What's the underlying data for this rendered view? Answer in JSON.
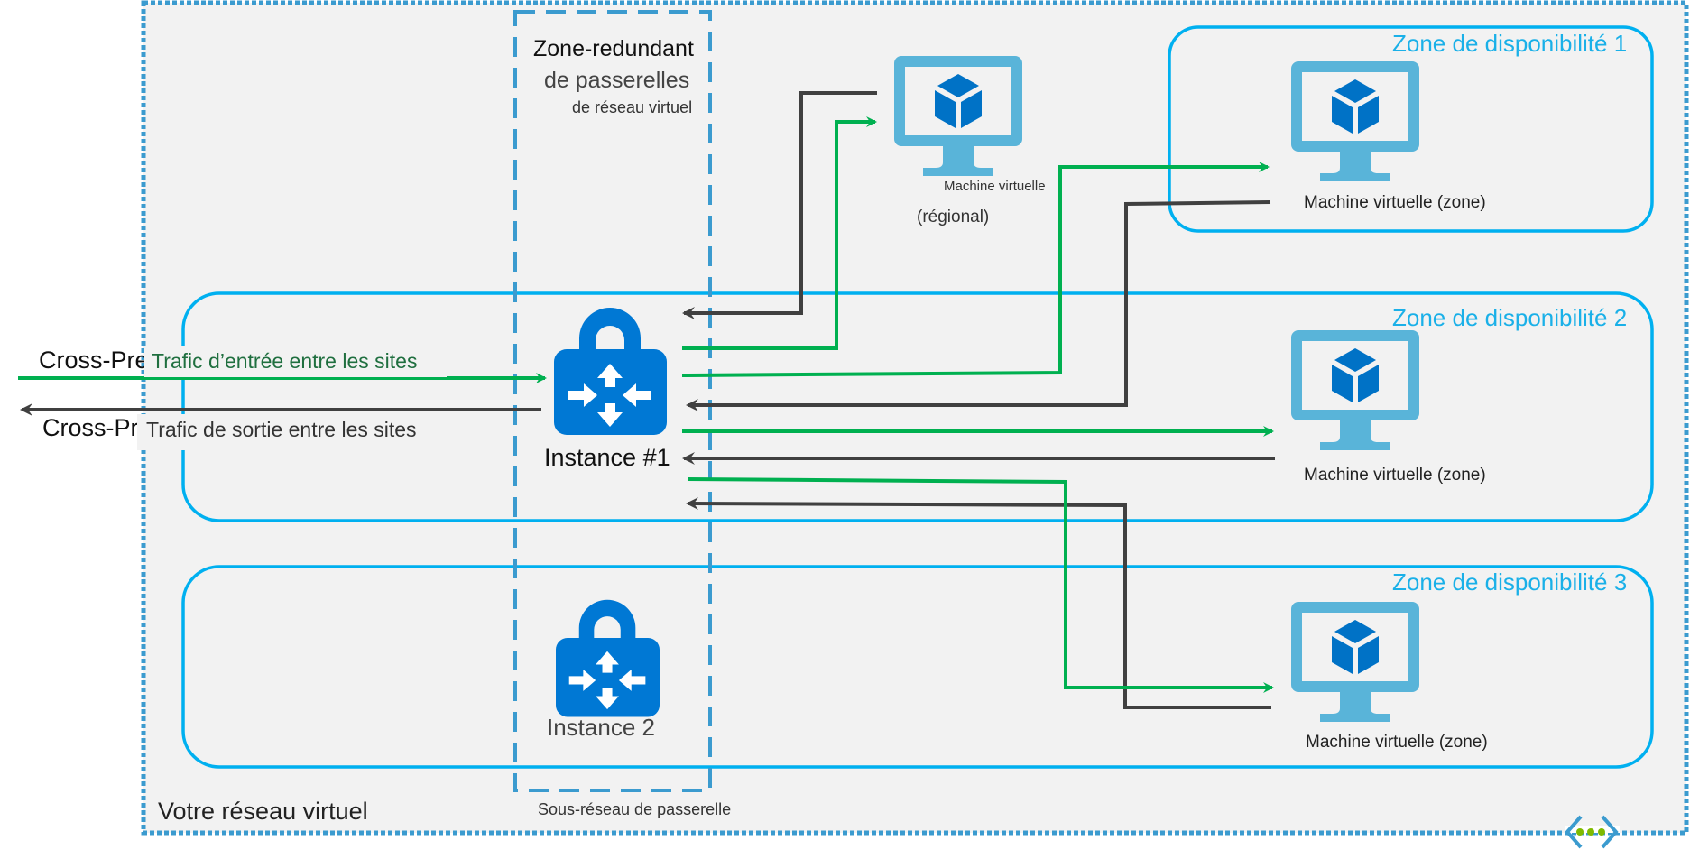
{
  "diagram": {
    "vnet_label": "Votre réseau virtuel",
    "gateway_group": {
      "title_line1": "Zone-redundant",
      "title_line2": "de passerelles",
      "title_line3": "de réseau virtuel",
      "subnet_label": "Sous-réseau de passerelle"
    },
    "instances": [
      {
        "label": "Instance #1",
        "icon": "vpn-gateway-lock-icon"
      },
      {
        "label": "Instance 2",
        "icon": "vpn-gateway-lock-icon"
      }
    ],
    "zones": [
      {
        "label": "Zone de disponibilité 1"
      },
      {
        "label": "Zone de disponibilité 2"
      },
      {
        "label": "Zone de disponibilité 3"
      }
    ],
    "vms": [
      {
        "label_line1": "Machine virtuelle",
        "label_line2": "(régional)",
        "icon": "virtual-machine-icon"
      },
      {
        "label": "Machine virtuelle (zone)",
        "icon": "virtual-machine-icon"
      },
      {
        "label": "Machine virtuelle (zone)",
        "icon": "virtual-machine-icon"
      },
      {
        "label": "Machine virtuelle (zone)",
        "icon": "virtual-machine-icon"
      }
    ],
    "traffic": {
      "ingress_underlying": "Cross-Premises",
      "ingress_label": "Trafic d’entrée entre les sites",
      "egress_underlying": "Cross-Premises",
      "egress_label": "Trafic de sortie entre les sites"
    },
    "colors": {
      "ingress": "#00b050",
      "egress": "#404040",
      "zone_border": "#00b0f0",
      "vnet_border": "#3b9bcf",
      "gateway_icon": "#0078d4",
      "vm_monitor": "#59b4d9",
      "vm_cube": "#0072c6",
      "background": "#f2f2f2"
    },
    "legend_icon": "virtual-network-icon"
  }
}
